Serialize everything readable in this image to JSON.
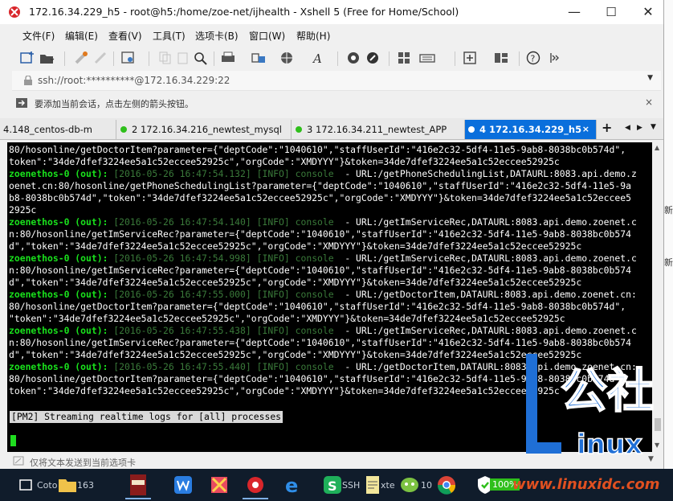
{
  "window": {
    "title": "172.16.34.229_h5 - root@h5:/home/zoe-net/ijhealth - Xshell 5 (Free for Home/School)",
    "minimize": "—",
    "maximize": "☐",
    "close": "✕"
  },
  "menu": [
    "文件(F)",
    "编辑(E)",
    "查看(V)",
    "工具(T)",
    "选项卡(B)",
    "窗口(W)",
    "帮助(H)"
  ],
  "address": {
    "text": "ssh://root:**********@172.16.34.229:22"
  },
  "hint": {
    "text": "要添加当前会话，点击左侧的箭头按钮。"
  },
  "tabs": [
    {
      "label": "4.148_centos-db-m"
    },
    {
      "label": "2 172.16.34.216_newtest_mysql"
    },
    {
      "label": "3 172.16.34.211_newtest_APP"
    },
    {
      "label": "4 172.16.34.229_h5"
    }
  ],
  "tab_add": "+",
  "terminal": {
    "lines": [
      {
        "t": "80/hosonline/getDoctorItem?parameter={\"deptCode\":\"1040610\",\"staffUserId\":\"416e2c32-5df4-11e5-9ab8-8038bc0b574d\","
      },
      {
        "t": "token\":\"34de7dfef3224ee5a1c52eccee52925c\",\"orgCode\":\"XMDYYY\"}&token=34de7dfef3224ee5a1c52eccee52925c"
      },
      {
        "p": "zoenethos-0 (out):",
        "m": " [2016-05-26 16:47:54.132] [INFO] console ",
        "t": " - URL:/getPhoneSchedulingList,DATAURL:8083.api.demo.z"
      },
      {
        "t": "oenet.cn:80/hosonline/getPhoneSchedulingList?parameter={\"deptCode\":\"1040610\",\"staffUserId\":\"416e2c32-5df4-11e5-9a"
      },
      {
        "t": "b8-8038bc0b574d\",\"token\":\"34de7dfef3224ee5a1c52eccee52925c\",\"orgCode\":\"XMDYYY\"}&token=34de7dfef3224ee5a1c52eccee5"
      },
      {
        "t": "2925c"
      },
      {
        "p": "zoenethos-0 (out):",
        "m": " [2016-05-26 16:47:54.140] [INFO] console ",
        "t": " - URL:/getImServiceRec,DATAURL:8083.api.demo.zoenet.c"
      },
      {
        "t": "n:80/hosonline/getImServiceRec?parameter={\"deptCode\":\"1040610\",\"staffUserId\":\"416e2c32-5df4-11e5-9ab8-8038bc0b574"
      },
      {
        "t": "d\",\"token\":\"34de7dfef3224ee5a1c52eccee52925c\",\"orgCode\":\"XMDYYY\"}&token=34de7dfef3224ee5a1c52eccee52925c"
      },
      {
        "p": "zoenethos-0 (out):",
        "m": " [2016-05-26 16:47:54.998] [INFO] console ",
        "t": " - URL:/getImServiceRec,DATAURL:8083.api.demo.zoenet.c"
      },
      {
        "t": "n:80/hosonline/getImServiceRec?parameter={\"deptCode\":\"1040610\",\"staffUserId\":\"416e2c32-5df4-11e5-9ab8-8038bc0b574"
      },
      {
        "t": "d\",\"token\":\"34de7dfef3224ee5a1c52eccee52925c\",\"orgCode\":\"XMDYYY\"}&token=34de7dfef3224ee5a1c52eccee52925c"
      },
      {
        "p": "zoenethos-0 (out):",
        "m": " [2016-05-26 16:47:55.000] [INFO] console ",
        "t": " - URL:/getDoctorItem,DATAURL:8083.api.demo.zoenet.cn:"
      },
      {
        "t": "80/hosonline/getDoctorItem?parameter={\"deptCode\":\"1040610\",\"staffUserId\":\"416e2c32-5df4-11e5-9ab8-8038bc0b574d\","
      },
      {
        "t": "\"token\":\"34de7dfef3224ee5a1c52eccee52925c\",\"orgCode\":\"XMDYYY\"}&token=34de7dfef3224ee5a1c52eccee52925c"
      },
      {
        "p": "zoenethos-0 (out):",
        "m": " [2016-05-26 16:47:55.438] [INFO] console ",
        "t": " - URL:/getImServiceRec,DATAURL:8083.api.demo.zoenet.c"
      },
      {
        "t": "n:80/hosonline/getImServiceRec?parameter={\"deptCode\":\"1040610\",\"staffUserId\":\"416e2c32-5df4-11e5-9ab8-8038bc0b574"
      },
      {
        "t": "d\",\"token\":\"34de7dfef3224ee5a1c52eccee52925c\",\"orgCode\":\"XMDYYY\"}&token=34de7dfef3224ee5a1c52eccee52925c"
      },
      {
        "p": "zoenethos-0 (out):",
        "m": " [2016-05-26 16:47:55.440] [INFO] console ",
        "t": " - URL:/getDoctorItem,DATAURL:8083.api.demo.zoenet.cn:"
      },
      {
        "t": "80/hosonline/getDoctorItem?parameter={\"deptCode\":\"1040610\",\"staffUserId\":\"416e2c32-5df4-11e5-9ab8-8038bc0b574d\","
      },
      {
        "t": "token\":\"34de7dfef3224ee5a1c52eccee52925c\",\"orgCode\":\"XMDYYY\"}&token=34de7dfef3224ee5a1c52eccee52925c"
      }
    ],
    "streaming": "[PM2] Streaming realtime logs for [all] processes"
  },
  "sendbar": {
    "text": "仅将文本发送到当前选项卡"
  },
  "taskbar": {
    "labels": [
      "Coto",
      "163",
      "SSH",
      "xte",
      "10"
    ],
    "battery": "100%"
  },
  "watermark": {
    "logo_text": "Linux公社",
    "url": "www.linuxidc.com"
  },
  "right_strip": [
    "新",
    "新"
  ],
  "colors": {
    "accent_tab": "#0a6fdc",
    "terminal_bg": "#000000",
    "process_green": "#19e11c",
    "taskbar_bg": "#101c2b"
  }
}
